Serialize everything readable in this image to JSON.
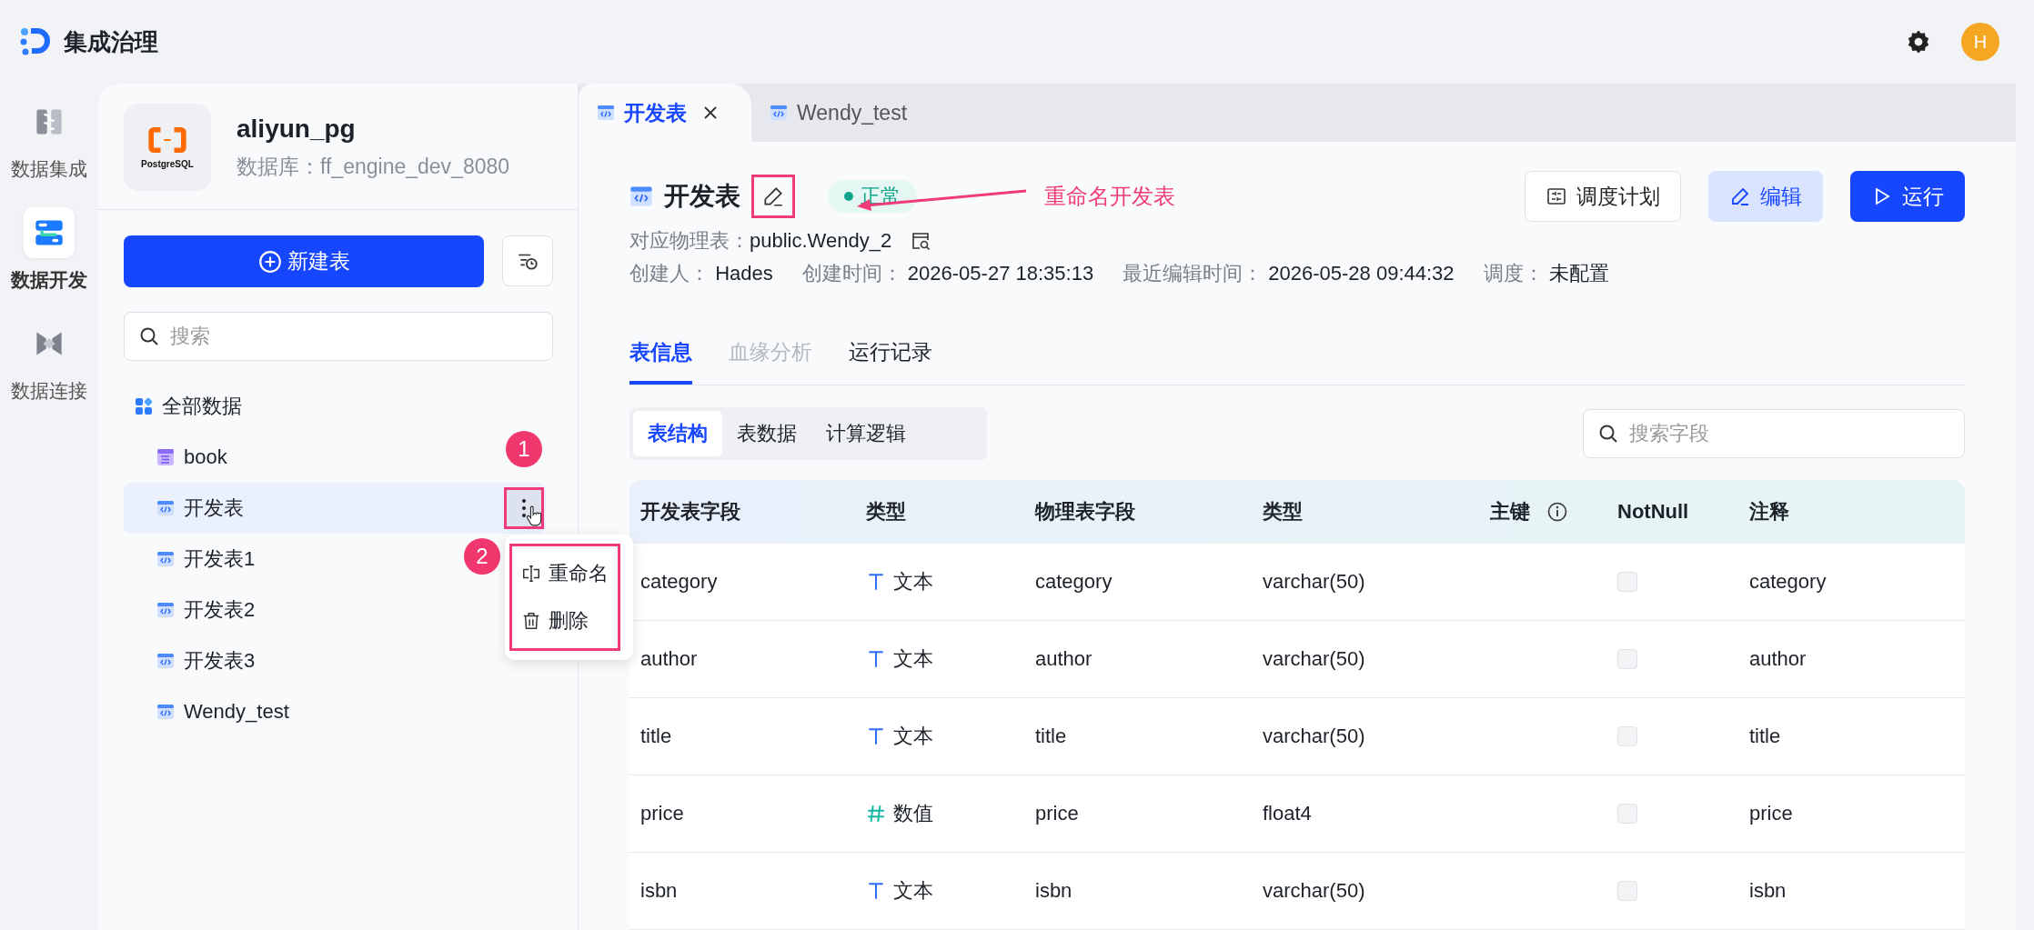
{
  "app": {
    "title": "集成治理",
    "avatar": "H"
  },
  "nav": [
    {
      "label": "数据集成",
      "kind": "integrate",
      "selected": false
    },
    {
      "label": "数据开发",
      "kind": "develop",
      "selected": true
    },
    {
      "label": "数据连接",
      "kind": "connect",
      "selected": false
    }
  ],
  "source": {
    "logo_text": "PostgreSQL",
    "name": "aliyun_pg",
    "database": "数据库：ff_engine_dev_8080"
  },
  "new_table_button": "新建表",
  "search": {
    "placeholder": "搜索"
  },
  "tree": {
    "label": "全部数据",
    "expanded": true,
    "children": [
      {
        "label": "book",
        "kind": "model",
        "selected": false
      },
      {
        "label": "开发表",
        "kind": "dev",
        "selected": true
      },
      {
        "label": "开发表1",
        "kind": "dev",
        "selected": false
      },
      {
        "label": "开发表2",
        "kind": "dev",
        "selected": false
      },
      {
        "label": "开发表3",
        "kind": "dev",
        "selected": false
      },
      {
        "label": "Wendy_test",
        "kind": "dev",
        "selected": false
      }
    ]
  },
  "context_menu": [
    {
      "label": "重命名",
      "kind": "rename"
    },
    {
      "label": "删除",
      "kind": "delete"
    }
  ],
  "tabs": [
    {
      "label": "开发表",
      "selected": true,
      "closable": true
    },
    {
      "label": "Wendy_test",
      "selected": false,
      "closable": false
    }
  ],
  "detail": {
    "title": "开发表",
    "status": "正常",
    "physical_label": "对应物理表：",
    "physical_value": "public.Wendy_2",
    "meta": [
      {
        "label": "创建人：",
        "value": "Hades"
      },
      {
        "label": "创建时间：",
        "value": "2026-05-27 18:35:13"
      },
      {
        "label": "最近编辑时间：",
        "value": "2026-05-28 09:44:32"
      },
      {
        "label": "调度：",
        "value": "未配置"
      }
    ]
  },
  "actions": [
    {
      "label": "调度计划",
      "kind": "schedule"
    },
    {
      "label": "编辑",
      "kind": "edit"
    },
    {
      "label": "运行",
      "kind": "run"
    }
  ],
  "section_tabs": [
    {
      "label": "表信息",
      "selected": true,
      "disabled": false
    },
    {
      "label": "血缘分析",
      "selected": false,
      "disabled": true
    },
    {
      "label": "运行记录",
      "selected": false,
      "disabled": false
    }
  ],
  "sub_tabs": [
    {
      "label": "表结构",
      "selected": true
    },
    {
      "label": "表数据",
      "selected": false
    },
    {
      "label": "计算逻辑",
      "selected": false
    }
  ],
  "field_search": {
    "placeholder": "搜索字段"
  },
  "table": {
    "columns": [
      "开发表字段",
      "类型",
      "物理表字段",
      "类型",
      "主键",
      "NotNull",
      "注释"
    ],
    "rows": [
      {
        "field": "category",
        "type": {
          "kind": "text",
          "label": "文本"
        },
        "physical_field": "category",
        "physical_type": "varchar(50)",
        "not_null": false,
        "comment": "category"
      },
      {
        "field": "author",
        "type": {
          "kind": "text",
          "label": "文本"
        },
        "physical_field": "author",
        "physical_type": "varchar(50)",
        "not_null": false,
        "comment": "author"
      },
      {
        "field": "title",
        "type": {
          "kind": "text",
          "label": "文本"
        },
        "physical_field": "title",
        "physical_type": "varchar(50)",
        "not_null": false,
        "comment": "title"
      },
      {
        "field": "price",
        "type": {
          "kind": "number",
          "label": "数值"
        },
        "physical_field": "price",
        "physical_type": "float4",
        "not_null": false,
        "comment": "price"
      },
      {
        "field": "isbn",
        "type": {
          "kind": "text",
          "label": "文本"
        },
        "physical_field": "isbn",
        "physical_type": "varchar(50)",
        "not_null": false,
        "comment": "isbn"
      }
    ]
  },
  "annotations": {
    "label": "重命名开发表",
    "steps": [
      "1",
      "2"
    ]
  }
}
